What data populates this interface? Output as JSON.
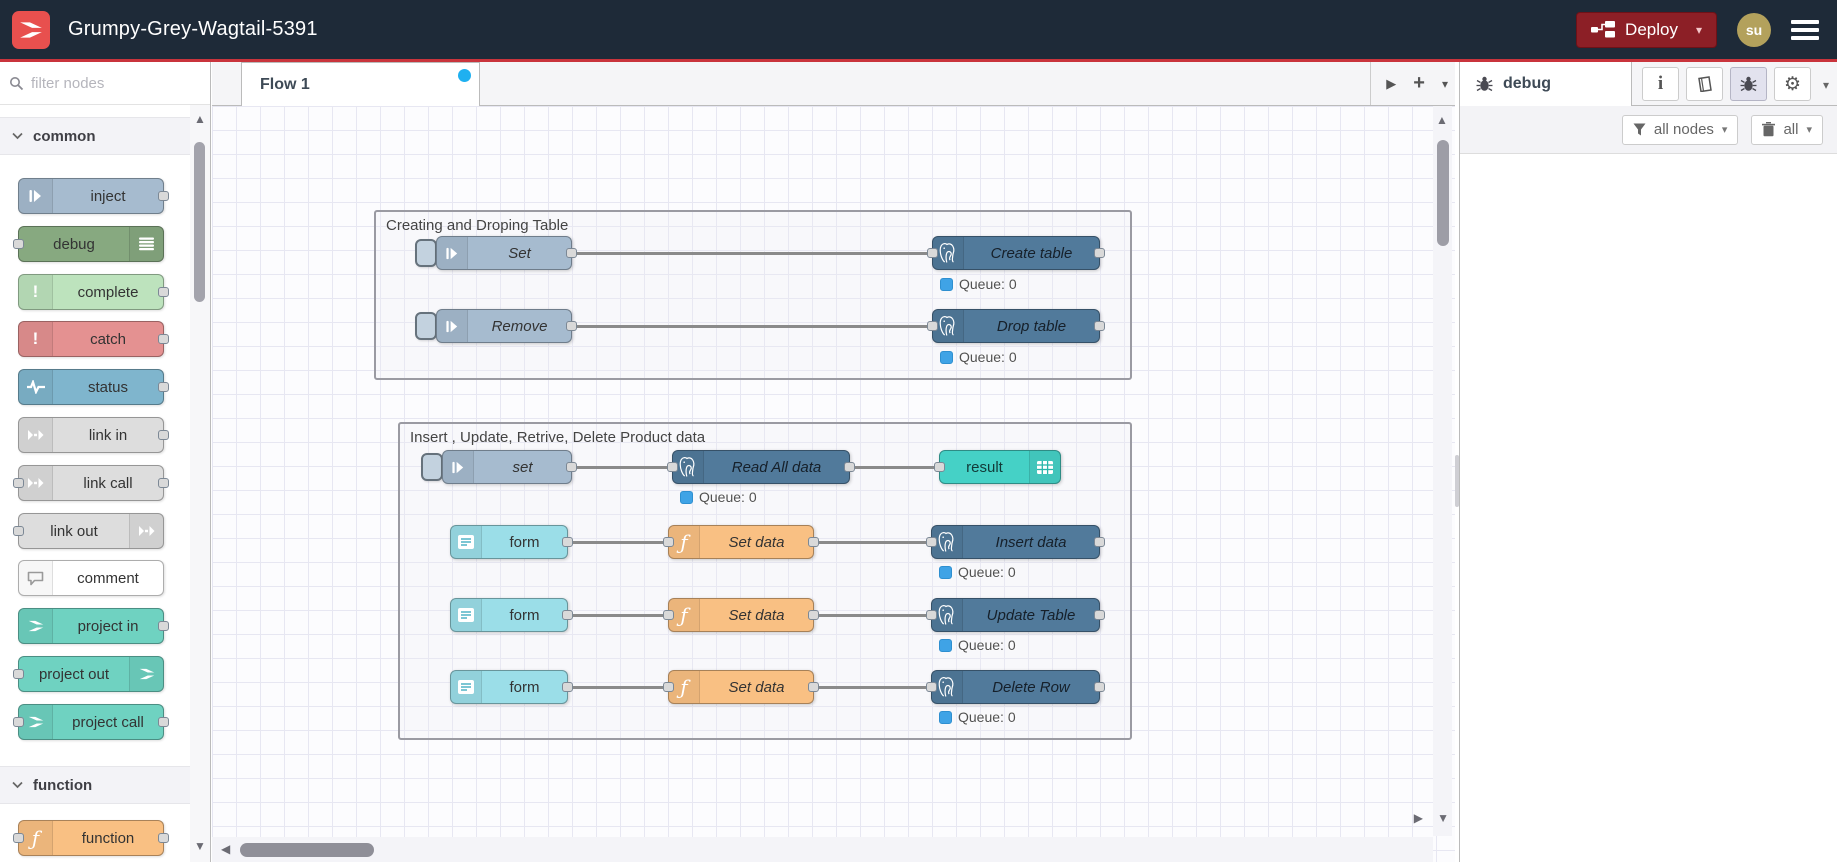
{
  "header": {
    "title": "Grumpy-Grey-Wagtail-5391",
    "deploy_label": "Deploy",
    "user_initials": "su"
  },
  "palette": {
    "filter_placeholder": "filter nodes",
    "categories": {
      "common": "common",
      "function": "function"
    },
    "nodes": {
      "inject": "inject",
      "debug": "debug",
      "complete": "complete",
      "catch": "catch",
      "status": "status",
      "link_in": "link in",
      "link_call": "link call",
      "link_out": "link out",
      "comment": "comment",
      "project_in": "project in",
      "project_out": "project out",
      "project_call": "project call",
      "function": "function"
    }
  },
  "workspace": {
    "tab_label": "Flow 1",
    "group1": {
      "title": "Creating and Droping Table",
      "row1": {
        "inject": "Set",
        "pg": "Create table",
        "status": "Queue: 0"
      },
      "row2": {
        "inject": "Remove",
        "pg": "Drop table",
        "status": "Queue: 0"
      }
    },
    "group2": {
      "title": "Insert , Update, Retrive, Delete Product data",
      "row1": {
        "inject": "set",
        "pg": "Read All data",
        "status": "Queue: 0",
        "result": "result"
      },
      "rows": [
        {
          "form": "form",
          "fn": "Set data",
          "pg": "Insert data",
          "status": "Queue: 0"
        },
        {
          "form": "form",
          "fn": "Set data",
          "pg": "Update Table",
          "status": "Queue: 0"
        },
        {
          "form": "form",
          "fn": "Set data",
          "pg": "Delete Row",
          "status": "Queue: 0"
        }
      ]
    }
  },
  "sidebar": {
    "tab_label": "debug",
    "filter_button_label": "all nodes",
    "clear_button_label": "all"
  },
  "colors": {
    "header_bg": "#1e2a38",
    "accent_red": "#c9343c",
    "logo_red": "#e8504e",
    "deploy_bg": "#8c1f26",
    "avatar_gold": "#b3a15c",
    "node_inject": "#a6bbcf",
    "node_debug": "#87a980",
    "node_complete": "#bde3bd",
    "node_catch": "#e49191",
    "node_status": "#7fb5cd",
    "node_link": "#dddddd",
    "node_comment": "#ffffff",
    "node_project": "#6fd2c1",
    "node_function": "#f9c083",
    "node_postgres": "#517a9b",
    "node_form": "#9bdee8",
    "node_result": "#45d1c6",
    "status_dot_blue": "#3fa3e6",
    "unsaved_dot_blue": "#1fb0f0"
  }
}
